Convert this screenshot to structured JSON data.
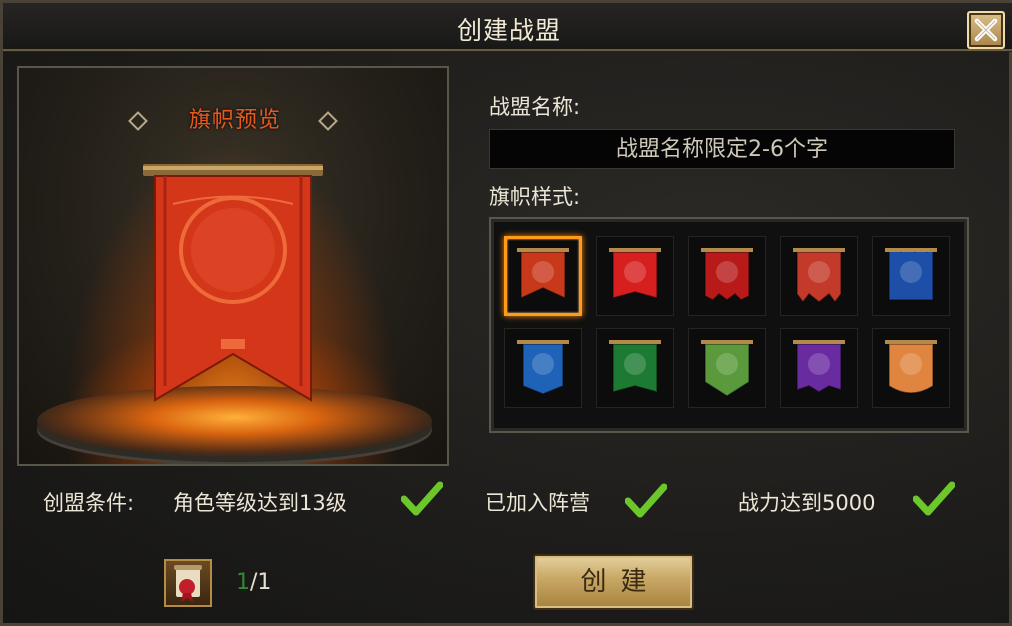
{
  "window": {
    "title": "创建战盟",
    "close_icon": "close-icon"
  },
  "preview": {
    "title": "旗帜预览",
    "banner_color": "#d4361a"
  },
  "form": {
    "name_label": "战盟名称:",
    "name_value": "",
    "name_placeholder": "战盟名称限定2-6个字",
    "style_label": "旗帜样式:"
  },
  "banners": [
    {
      "color": "#c8391b",
      "selected": true
    },
    {
      "color": "#d81f1f",
      "selected": false
    },
    {
      "color": "#b81a1a",
      "selected": false
    },
    {
      "color": "#c43a2a",
      "selected": false
    },
    {
      "color": "#1e4fa8",
      "selected": false
    },
    {
      "color": "#1f63b8",
      "selected": false
    },
    {
      "color": "#1c7a32",
      "selected": false
    },
    {
      "color": "#5a9a3c",
      "selected": false
    },
    {
      "color": "#6a2aa0",
      "selected": false
    },
    {
      "color": "#e08540",
      "selected": false
    }
  ],
  "conditions": {
    "label": "创盟条件:",
    "items": [
      {
        "text": "角色等级达到13级",
        "met": true
      },
      {
        "text": "已加入阵营",
        "met": true
      },
      {
        "text": "战力达到5000",
        "met": true
      }
    ],
    "check_color": "#6cc82a"
  },
  "cost": {
    "icon": "scroll-item-icon",
    "current": "1",
    "separator": "/1"
  },
  "actions": {
    "create_label": "创建"
  }
}
